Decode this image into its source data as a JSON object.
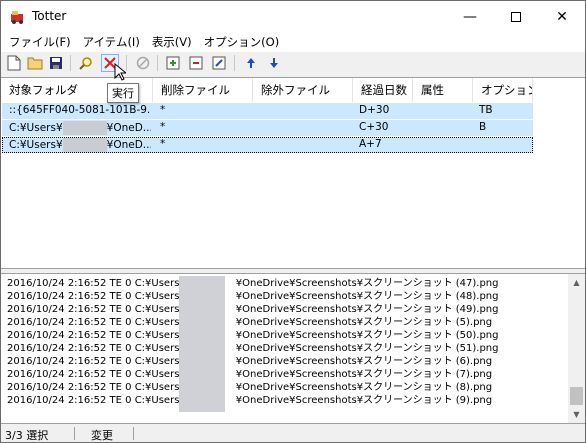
{
  "window": {
    "title": "Totter"
  },
  "menu": [
    "ファイル(F)",
    "アイテム(I)",
    "表示(V)",
    "オプション(O)"
  ],
  "toolbar": {
    "buttons": [
      "new-icon",
      "open-folder-icon",
      "save-icon",
      "find-icon",
      "run-icon",
      "stop-icon",
      "add-item-icon",
      "remove-item-icon",
      "edit-item-icon",
      "move-up-icon",
      "move-down-icon"
    ],
    "tooltip": "実行"
  },
  "list": {
    "columns": [
      "対象フォルダ",
      "削除ファイル",
      "除外ファイル",
      "経過日数",
      "属性",
      "オプション"
    ],
    "rows": [
      {
        "folder": "::{645FF040-5081-101B-9...",
        "delete": "*",
        "exclude": "",
        "days": "D+30",
        "attr": "",
        "option": "TB"
      },
      {
        "folder_pre": "C:¥Users¥",
        "folder_post": "¥OneD...",
        "delete": "*",
        "exclude": "",
        "days": "C+30",
        "attr": "",
        "option": "B"
      },
      {
        "folder_pre": "C:¥Users¥",
        "folder_post": "¥OneD...",
        "delete": "*",
        "exclude": "",
        "days": "A+7",
        "attr": "",
        "option": ""
      }
    ]
  },
  "log": {
    "lines": [
      {
        "prefix": "2016/10/24 2:16:52 TE 0 C:¥Users¥",
        "suffix": "¥OneDrive¥Screenshots¥スクリーンショット (47).png"
      },
      {
        "prefix": "2016/10/24 2:16:52 TE 0 C:¥Users¥",
        "suffix": "¥OneDrive¥Screenshots¥スクリーンショット (48).png"
      },
      {
        "prefix": "2016/10/24 2:16:52 TE 0 C:¥Users¥",
        "suffix": "¥OneDrive¥Screenshots¥スクリーンショット (49).png"
      },
      {
        "prefix": "2016/10/24 2:16:52 TE 0 C:¥Users¥",
        "suffix": "¥OneDrive¥Screenshots¥スクリーンショット (5).png"
      },
      {
        "prefix": "2016/10/24 2:16:52 TE 0 C:¥Users¥",
        "suffix": "¥OneDrive¥Screenshots¥スクリーンショット (50).png"
      },
      {
        "prefix": "2016/10/24 2:16:52 TE 0 C:¥Users¥",
        "suffix": "¥OneDrive¥Screenshots¥スクリーンショット (51).png"
      },
      {
        "prefix": "2016/10/24 2:16:52 TE 0 C:¥Users¥",
        "suffix": "¥OneDrive¥Screenshots¥スクリーンショット (6).png"
      },
      {
        "prefix": "2016/10/24 2:16:52 TE 0 C:¥Users¥",
        "suffix": "¥OneDrive¥Screenshots¥スクリーンショット (7).png"
      },
      {
        "prefix": "2016/10/24 2:16:52 TE 0 C:¥Users¥",
        "suffix": "¥OneDrive¥Screenshots¥スクリーンショット (8).png"
      },
      {
        "prefix": "2016/10/24 2:16:52 TE 0 C:¥Users¥",
        "suffix": "¥OneDrive¥Screenshots¥スクリーンショット (9).png"
      }
    ]
  },
  "status": {
    "selection": "3/3 選択",
    "state": "変更"
  },
  "colors": {
    "selection": "#cce8ff",
    "run_red": "#e02020",
    "arrow_blue": "#1e4fc2"
  }
}
